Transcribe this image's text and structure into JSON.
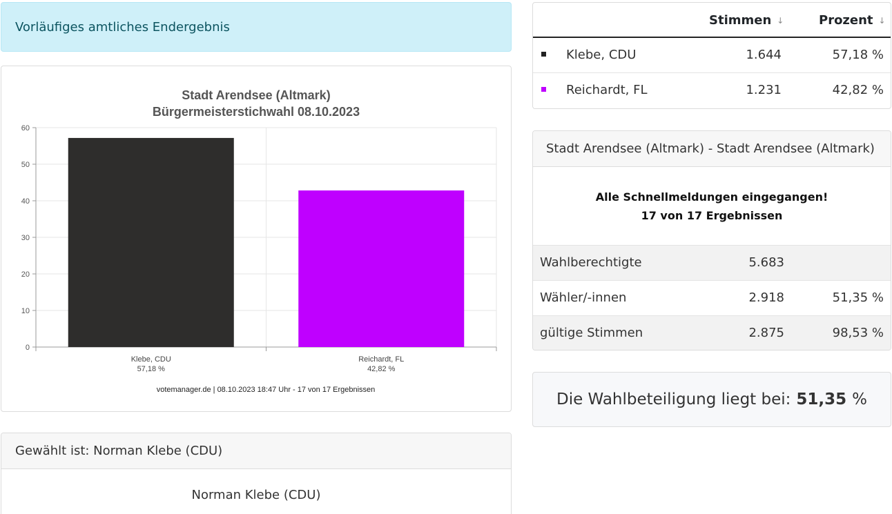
{
  "status": {
    "text": "Vorläufiges amtliches Endergebnis"
  },
  "chart_data": {
    "type": "bar",
    "title": "Stadt Arendsee (Altmark)",
    "subtitle": "Bürgermeisterstichwahl 08.10.2023",
    "categories": [
      "Klebe, CDU",
      "Reichardt, FL"
    ],
    "category_sublabels": [
      "57,18 %",
      "42,82 %"
    ],
    "values": [
      57.18,
      42.82
    ],
    "colors": [
      "#2e2d2c",
      "#bf00ff"
    ],
    "ylim": [
      0,
      60
    ],
    "yticks": [
      0,
      10,
      20,
      30,
      40,
      50,
      60
    ],
    "grid": true,
    "xlabel": "",
    "ylabel": "",
    "footer": "votemanager.de | 08.10.2023 18:47 Uhr - 17 von 17 Ergebnissen"
  },
  "elected": {
    "header": "Gewählt ist: Norman Klebe (CDU)",
    "name": "Norman Klebe (CDU)"
  },
  "results": {
    "col_votes": "Stimmen",
    "col_percent": "Prozent",
    "sort_icon": "↓",
    "rows": [
      {
        "name": "Klebe, CDU",
        "votes": "1.644",
        "percent": "57,18 %",
        "color": "#222222"
      },
      {
        "name": "Reichardt, FL",
        "votes": "1.231",
        "percent": "42,82 %",
        "color": "#bf00ff"
      }
    ]
  },
  "info": {
    "header": "Stadt Arendsee (Altmark) - Stadt Arendsee (Altmark)",
    "message_line1": "Alle Schnellmeldungen eingegangen!",
    "message_line2": "17 von 17 Ergebnissen",
    "rows": [
      {
        "label": "Wahlberechtigte",
        "value": "5.683",
        "percent": ""
      },
      {
        "label": "Wähler/-innen",
        "value": "2.918",
        "percent": "51,35 %"
      },
      {
        "label": "gültige Stimmen",
        "value": "2.875",
        "percent": "98,53 %"
      }
    ]
  },
  "turnout": {
    "prefix": "Die Wahlbeteiligung liegt bei:",
    "value": "51,35",
    "unit": "%"
  }
}
